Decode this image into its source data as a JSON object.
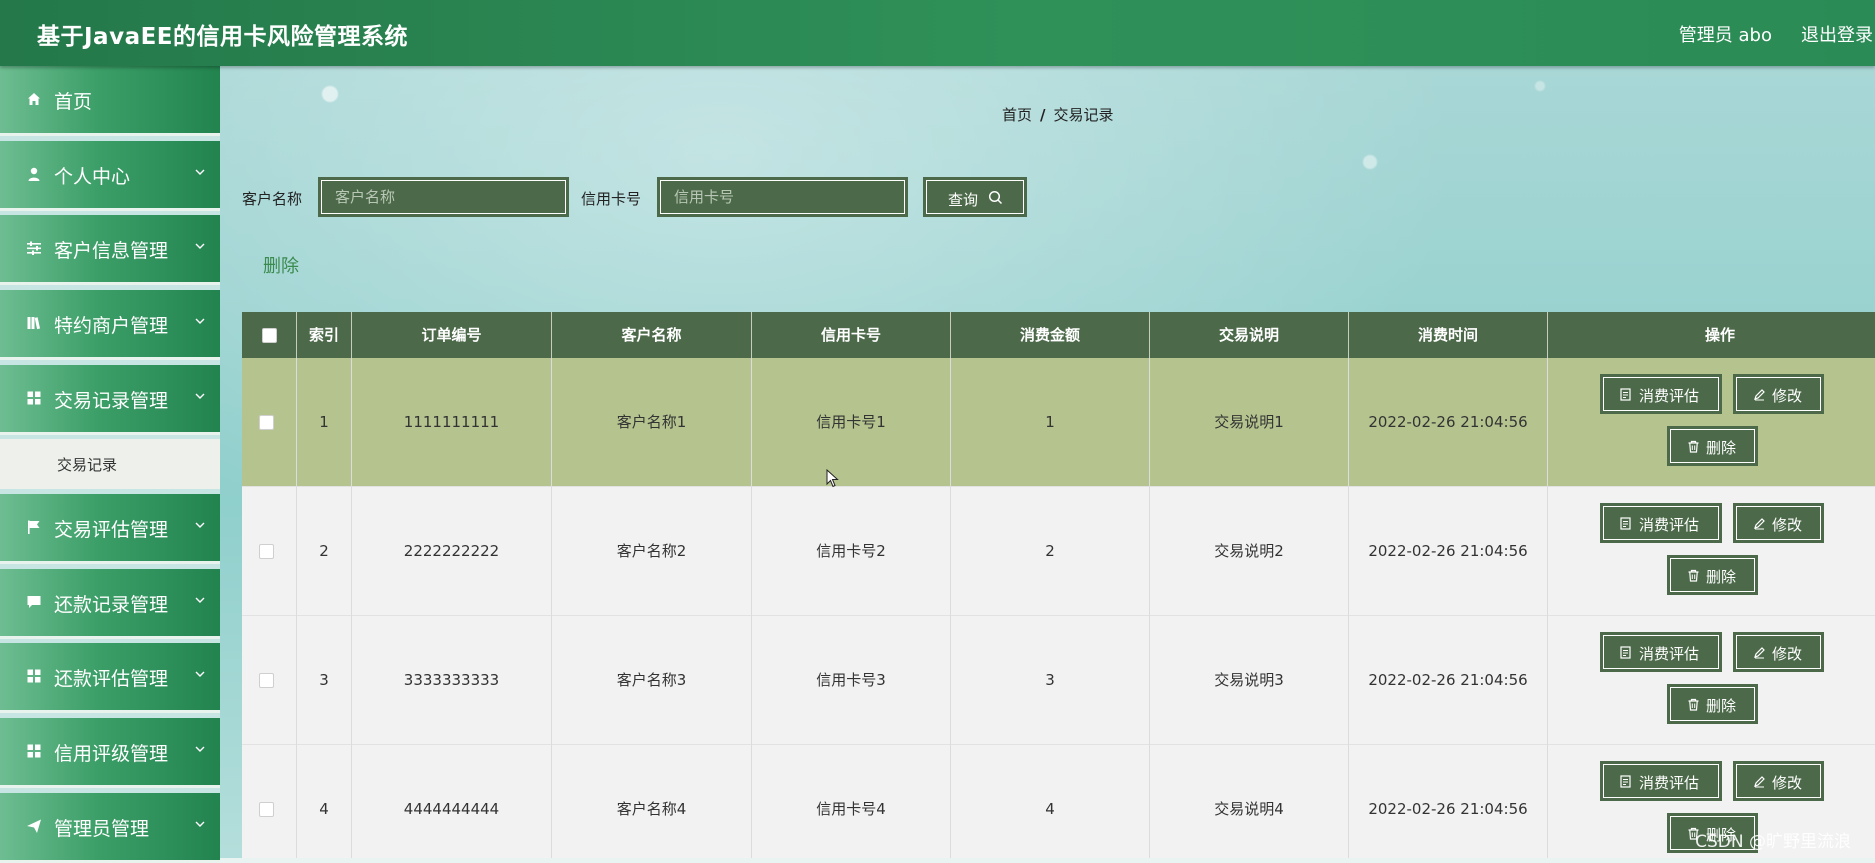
{
  "header": {
    "title": "基于JavaEE的信用卡风险管理系统",
    "admin": "管理员 abo",
    "logout": "退出登录"
  },
  "sidebar": {
    "items": [
      {
        "label": "首页",
        "icon": "home-icon",
        "chevron": false
      },
      {
        "label": "个人中心",
        "icon": "user-icon",
        "chevron": true
      },
      {
        "label": "客户信息管理",
        "icon": "sliders-icon",
        "chevron": true
      },
      {
        "label": "特约商户管理",
        "icon": "books-icon",
        "chevron": true
      },
      {
        "label": "交易记录管理",
        "icon": "grid-icon",
        "chevron": true
      },
      {
        "label": "交易评估管理",
        "icon": "flag-icon",
        "chevron": true
      },
      {
        "label": "还款记录管理",
        "icon": "chat-icon",
        "chevron": true
      },
      {
        "label": "还款评估管理",
        "icon": "grid-icon",
        "chevron": true
      },
      {
        "label": "信用评级管理",
        "icon": "grid-icon",
        "chevron": true
      },
      {
        "label": "管理员管理",
        "icon": "send-icon",
        "chevron": true
      }
    ],
    "submenu": {
      "label": "交易记录"
    }
  },
  "breadcrumb": {
    "home": "首页",
    "sep": "/",
    "current": "交易记录"
  },
  "search": {
    "customer_label": "客户名称",
    "customer_placeholder": "客户名称",
    "card_label": "信用卡号",
    "card_placeholder": "信用卡号",
    "query_label": "查询"
  },
  "bulk_delete": "删除",
  "table": {
    "columns": [
      "索引",
      "订单编号",
      "客户名称",
      "信用卡号",
      "消费金额",
      "交易说明",
      "消费时间",
      "操作"
    ],
    "rows": [
      {
        "index": "1",
        "order": "1111111111",
        "customer": "客户名称1",
        "card": "信用卡号1",
        "amount": "1",
        "desc": "交易说明1",
        "time": "2022-02-26 21:04:56"
      },
      {
        "index": "2",
        "order": "2222222222",
        "customer": "客户名称2",
        "card": "信用卡号2",
        "amount": "2",
        "desc": "交易说明2",
        "time": "2022-02-26 21:04:56"
      },
      {
        "index": "3",
        "order": "3333333333",
        "customer": "客户名称3",
        "card": "信用卡号3",
        "amount": "3",
        "desc": "交易说明3",
        "time": "2022-02-26 21:04:56"
      },
      {
        "index": "4",
        "order": "4444444444",
        "customer": "客户名称4",
        "card": "信用卡号4",
        "amount": "4",
        "desc": "交易说明4",
        "time": "2022-02-26 21:04:56"
      }
    ],
    "actions": {
      "assess": "消费评估",
      "edit": "修改",
      "delete": "删除"
    }
  },
  "watermark": "CSDN @旷野里流浪",
  "colors": {
    "header": "#2b8b56",
    "table_header": "#4c6a4a",
    "hover_row": "#b5c48f",
    "row": "#f2f2f2"
  }
}
